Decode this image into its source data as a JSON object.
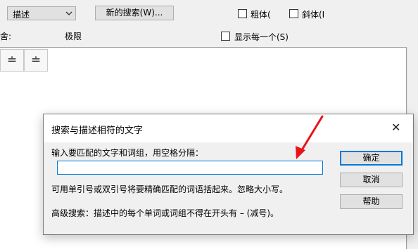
{
  "toolbar": {
    "field_combo_value": "描述",
    "new_search_label": "新的搜索(W)...",
    "bold_label": "粗体(",
    "italic_label": "斜体(I"
  },
  "row2": {
    "left_label": "舍:",
    "limit_label": "极限",
    "show_each_label": "显示每一个(S)"
  },
  "ops": [
    "≐",
    "≐"
  ],
  "dialog": {
    "title": "搜索与描述相符的文字",
    "prompt": "输入要匹配的文字和词组，用空格分隔：",
    "input_value": "",
    "hint": "可用单引号或双引号将要精确匹配的词语括起来。忽略大小写。",
    "advanced": "高级搜索：描述中的每个单词或词组不得在开头有 – (减号)。",
    "ok_label": "确定",
    "cancel_label": "取消",
    "help_label": "帮助",
    "close_glyph": "✕"
  },
  "annotation": {
    "color": "#e8141b"
  }
}
